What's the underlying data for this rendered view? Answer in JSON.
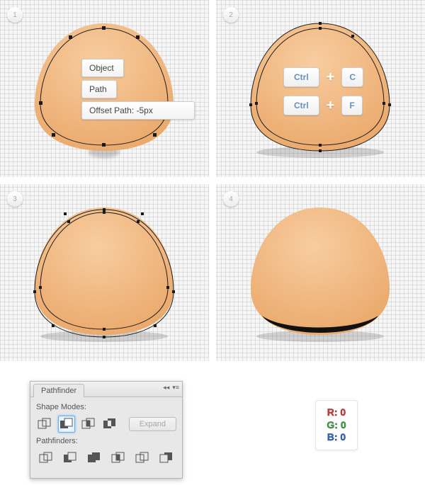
{
  "steps": {
    "s1": "1",
    "s2": "2",
    "s3": "3",
    "s4": "4"
  },
  "ctx": {
    "object": "Object",
    "path": "Path",
    "offset": "Offset Path: -5px"
  },
  "keys": {
    "ctrl": "Ctrl",
    "plus": "+",
    "c": "C",
    "f": "F"
  },
  "pathfinder": {
    "title": "Pathfinder",
    "shape_modes": "Shape Modes:",
    "pathfinders": "Pathfinders:",
    "expand": "Expand",
    "collapse": "◂◂",
    "menu": "▾≡"
  },
  "rgb": {
    "r": "R: 0",
    "g": "G: 0",
    "b": "B: 0"
  },
  "colors": {
    "shape_fill_light": "#f3b882",
    "shape_fill_dark": "#e9a667",
    "outline": "#1a1a1a"
  }
}
